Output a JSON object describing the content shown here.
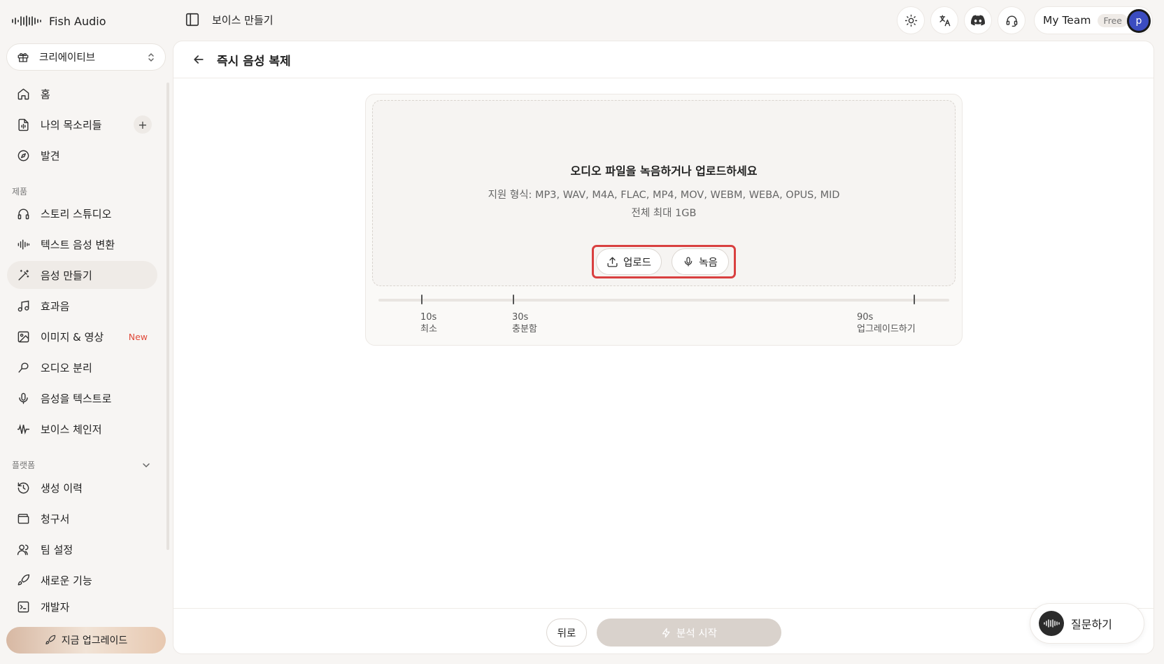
{
  "brand": {
    "name": "Fish Audio",
    "icon": "waveform-logo-icon"
  },
  "workspace": {
    "label": "크리에이티브",
    "icon": "gift-icon"
  },
  "sidebar": {
    "top_items": [
      {
        "label": "홈",
        "icon": "home-icon"
      },
      {
        "label": "나의 목소리들",
        "icon": "file-audio-icon",
        "action": "+"
      },
      {
        "label": "발견",
        "icon": "compass-icon"
      }
    ],
    "products_label": "제품",
    "product_items": [
      {
        "label": "스토리 스튜디오",
        "icon": "headphones-icon"
      },
      {
        "label": "텍스트 음성 변환",
        "icon": "audio-lines-icon"
      },
      {
        "label": "음성 만들기",
        "icon": "magic-wand-icon",
        "active": true
      },
      {
        "label": "효과음",
        "icon": "music-icon"
      },
      {
        "label": "이미지 & 영상",
        "icon": "image-icon",
        "badge": "New"
      },
      {
        "label": "오디오 분리",
        "icon": "separate-icon"
      },
      {
        "label": "음성을 텍스트로",
        "icon": "mic-icon"
      },
      {
        "label": "보이스 체인저",
        "icon": "wave-icon"
      }
    ],
    "platform_label": "플랫폼",
    "platform_items": [
      {
        "label": "생성 이력",
        "icon": "history-icon"
      },
      {
        "label": "청구서",
        "icon": "wallet-icon"
      },
      {
        "label": "팀 설정",
        "icon": "users-icon"
      },
      {
        "label": "새로운 기능",
        "icon": "rocket-icon"
      },
      {
        "label": "개발자",
        "icon": "terminal-icon"
      }
    ],
    "upgrade_label": "지금 업그레이드"
  },
  "topbar": {
    "breadcrumb": "보이스 만들기",
    "icons": [
      "sun-icon",
      "translate-icon",
      "discord-icon",
      "headset-icon"
    ],
    "team_name": "My Team",
    "plan": "Free",
    "avatar_letter": "p"
  },
  "page": {
    "title": "즉시 음성 복제",
    "dropzone": {
      "title": "오디오 파일을 녹음하거나 업로드하세요",
      "formats": "지원 형식: MP3, WAV, M4A, FLAC, MP4, MOV, WEBM, WEBA, OPUS, MID",
      "max_size": "전체 최대 1GB",
      "upload_label": "업로드",
      "record_label": "녹음"
    },
    "timeline": [
      {
        "value": "10s",
        "label": "최소"
      },
      {
        "value": "30s",
        "label": "충분함"
      },
      {
        "value": "90s",
        "label": "업그레이드하기"
      }
    ],
    "footer": {
      "back_label": "뒤로",
      "analyze_label": "분석 시작"
    }
  },
  "help": {
    "label": "질문하기"
  },
  "colors": {
    "accent_active_bg": "#efebe7",
    "highlight_red": "#d94040",
    "badge_new": "#e04a3a"
  }
}
